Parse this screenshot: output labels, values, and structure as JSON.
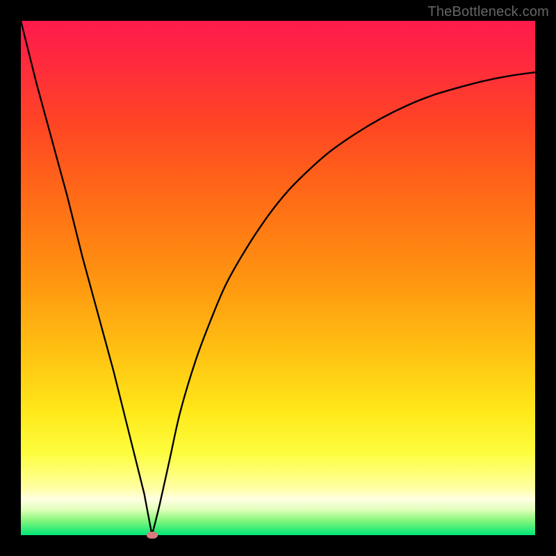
{
  "watermark": "TheBottleneck.com",
  "colors": {
    "frame": "#000000",
    "curve": "#000000",
    "marker": "#d97a7f",
    "gradient_stops": [
      "#ff1a4d",
      "#ff2a3d",
      "#ff4524",
      "#ff6a17",
      "#ff9410",
      "#ffc012",
      "#ffe81a",
      "#fdfd3e",
      "#ffff78",
      "#ffffa8",
      "#ffffe2",
      "#e2ffbc",
      "#8cf77e",
      "#00e676"
    ]
  },
  "chart_data": {
    "type": "line",
    "title": "",
    "xlabel": "",
    "ylabel": "",
    "xlim": [
      0,
      100
    ],
    "ylim": [
      0,
      100
    ],
    "legend": false,
    "grid": false,
    "series": [
      {
        "name": "bottleneck-curve",
        "x": [
          0,
          3,
          6,
          9,
          12,
          15,
          18,
          21,
          24,
          25.5,
          27,
          29,
          31,
          34,
          37,
          40,
          44,
          48,
          52,
          56,
          60,
          65,
          70,
          75,
          80,
          85,
          90,
          95,
          100
        ],
        "y": [
          100,
          88,
          77,
          66,
          54,
          43,
          32,
          20,
          8,
          0,
          6,
          15,
          24,
          34,
          42,
          49,
          56,
          62,
          67,
          71,
          74.5,
          78,
          81,
          83.5,
          85.5,
          87,
          88.3,
          89.3,
          90
        ]
      }
    ],
    "marker": {
      "x": 25.5,
      "y": 0
    }
  }
}
